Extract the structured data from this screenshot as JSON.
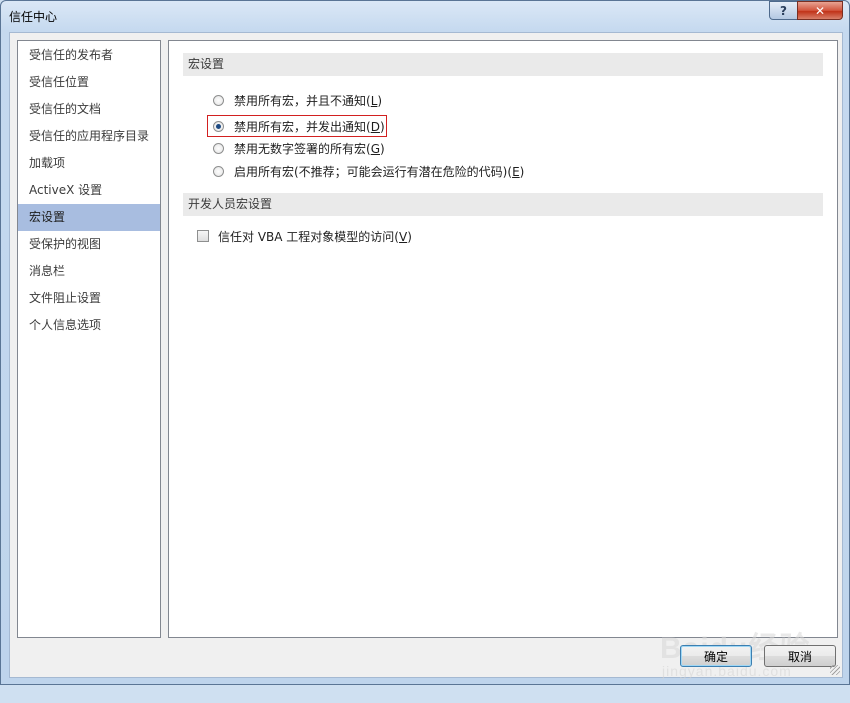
{
  "window": {
    "title": "信任中心"
  },
  "titlebar": {
    "help_glyph": "?",
    "close_glyph": "✕"
  },
  "sidebar": {
    "items": [
      {
        "label": "受信任的发布者",
        "selected": false
      },
      {
        "label": "受信任位置",
        "selected": false
      },
      {
        "label": "受信任的文档",
        "selected": false
      },
      {
        "label": "受信任的应用程序目录",
        "selected": false
      },
      {
        "label": "加载项",
        "selected": false
      },
      {
        "label": "ActiveX 设置",
        "selected": false
      },
      {
        "label": "宏设置",
        "selected": true
      },
      {
        "label": "受保护的视图",
        "selected": false
      },
      {
        "label": "消息栏",
        "selected": false
      },
      {
        "label": "文件阻止设置",
        "selected": false
      },
      {
        "label": "个人信息选项",
        "selected": false
      }
    ]
  },
  "macro_section": {
    "header": "宏设置",
    "options": [
      {
        "text": "禁用所有宏，并且不通知(",
        "key": "L",
        "tail": ")",
        "checked": false
      },
      {
        "text": "禁用所有宏，并发出通知(",
        "key": "D",
        "tail": ")",
        "checked": true
      },
      {
        "text": "禁用无数字签署的所有宏(",
        "key": "G",
        "tail": ")",
        "checked": false
      },
      {
        "text": "启用所有宏(不推荐；可能会运行有潜在危险的代码)(",
        "key": "E",
        "tail": ")",
        "checked": false
      }
    ]
  },
  "developer_section": {
    "header": "开发人员宏设置",
    "checkbox": {
      "text": "信任对 VBA 工程对象模型的访问(",
      "key": "V",
      "tail": ")",
      "checked": false
    }
  },
  "buttons": {
    "ok": "确定",
    "cancel": "取消"
  },
  "watermark": {
    "main": "Baidu经验",
    "sub": "jingyan.baidu.com"
  }
}
